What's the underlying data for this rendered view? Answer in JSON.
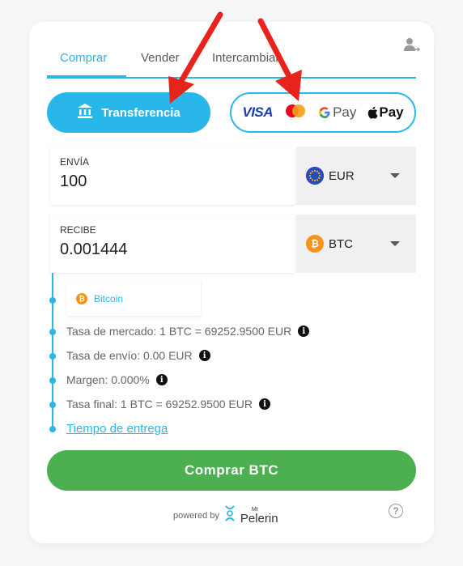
{
  "tabs": [
    "Comprar",
    "Vender",
    "Intercambiar"
  ],
  "payment": {
    "transfer_label": "Transferencia",
    "visa": "VISA",
    "gpay": "Pay",
    "applepay": "Pay"
  },
  "send": {
    "label": "ENVÍA",
    "value": "100",
    "currency": "EUR"
  },
  "receive": {
    "label": "RECIBE",
    "value": "0.001444",
    "currency": "BTC"
  },
  "network": {
    "label": "Bitcoin"
  },
  "info": [
    "Tasa de mercado: 1 BTC = 69252.9500 EUR",
    "Tasa de envío: 0.00 EUR",
    "Margen: 0.000%",
    "Tasa final: 1 BTC = 69252.9500 EUR"
  ],
  "delivery_link": "Tiempo de entrega",
  "buy_button": "Comprar BTC",
  "footer": {
    "powered": "powered by",
    "brand_small": "Mt",
    "brand": "Pelerin"
  },
  "colors": {
    "accent": "#29b6e8",
    "buy": "#4caf50",
    "arrow": "#e8231c"
  }
}
